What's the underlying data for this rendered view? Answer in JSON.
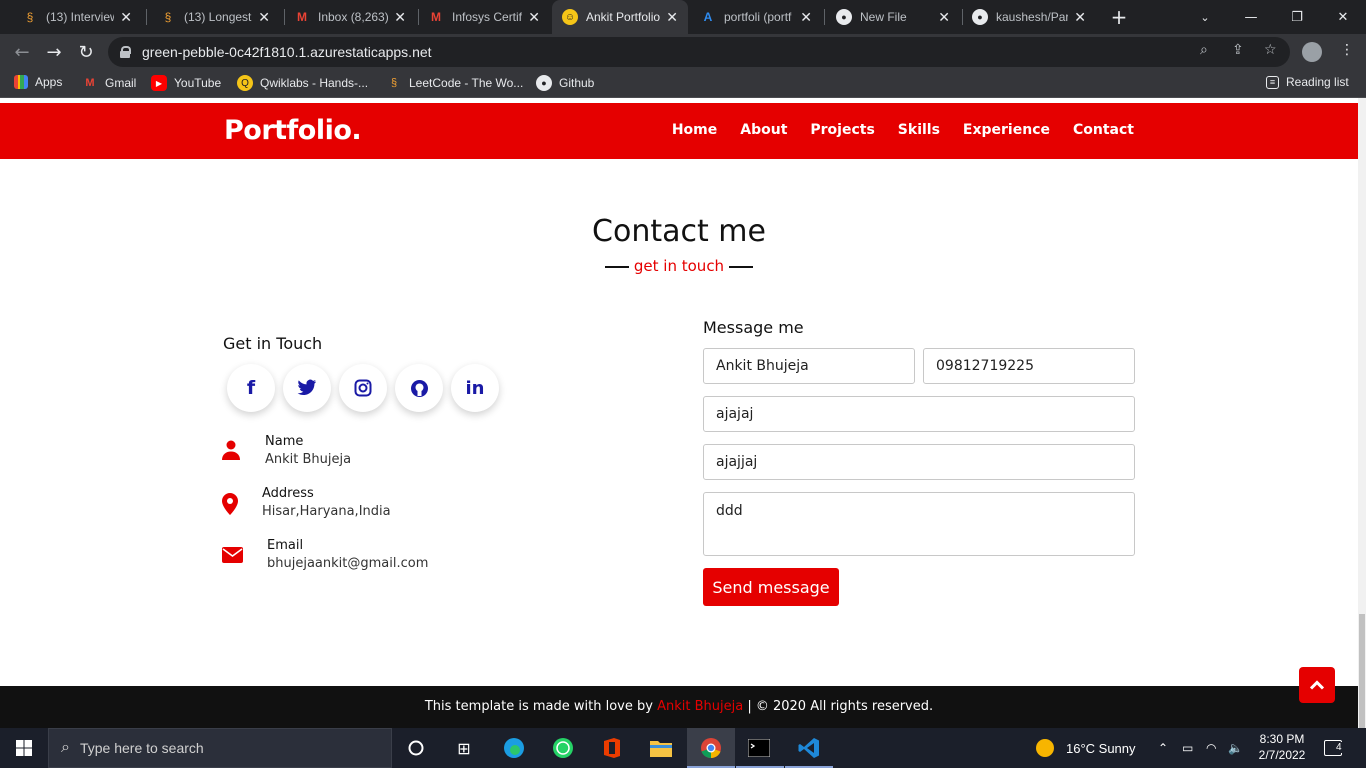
{
  "browser": {
    "tabs": [
      {
        "title": "(13) Interview",
        "icon": "geeksforgeeks-icon"
      },
      {
        "title": "(13) Longest",
        "icon": "geeksforgeeks-icon"
      },
      {
        "title": "Inbox (8,263)",
        "icon": "gmail-icon"
      },
      {
        "title": "Infosys Certifi",
        "icon": "gmail-icon"
      },
      {
        "title": "Ankit Portfolio",
        "icon": "emoji-icon"
      },
      {
        "title": "portfoli (portf",
        "icon": "azure-icon"
      },
      {
        "title": "New File",
        "icon": "github-icon"
      },
      {
        "title": "kaushesh/Par",
        "icon": "github-icon"
      }
    ],
    "url": "green-pebble-0c42f1810.1.azurestaticapps.net",
    "bookmarks": [
      "Apps",
      "Gmail",
      "YouTube",
      "Qwiklabs - Hands-...",
      "LeetCode - The Wo...",
      "Github"
    ],
    "reading_list": "Reading list"
  },
  "site": {
    "logo": "Portfolio.",
    "nav": [
      "Home",
      "About",
      "Projects",
      "Skills",
      "Experience",
      "Contact"
    ],
    "accent": "#e50000",
    "section_title": "Contact me",
    "section_subtitle": "get in touch",
    "get_in_touch": "Get in Touch",
    "social": [
      "f",
      "t",
      "ig",
      "gh",
      "in"
    ],
    "info": [
      {
        "label": "Name",
        "value": "Ankit Bhujeja",
        "icon": "user-icon"
      },
      {
        "label": "Address",
        "value": "Hisar,Haryana,India",
        "icon": "map-pin-icon"
      },
      {
        "label": "Email",
        "value": "bhujejaankit@gmail.com",
        "icon": "envelope-icon"
      }
    ],
    "message_title": "Message me",
    "form": {
      "name": "Ankit Bhujeja",
      "phone": "09812719225",
      "email": "ajajaj",
      "subject": "ajajjaj",
      "message": "ddd"
    },
    "send_label": "Send message",
    "footer": {
      "prefix": "This template is made with love by",
      "author": "Ankit Bhujeja",
      "suffix": "| © 2020 All rights reserved."
    }
  },
  "taskbar": {
    "search_placeholder": "Type here to search",
    "weather": "16°C  Sunny",
    "time": "8:30 PM",
    "date": "2/7/2022",
    "notifications": "4"
  }
}
